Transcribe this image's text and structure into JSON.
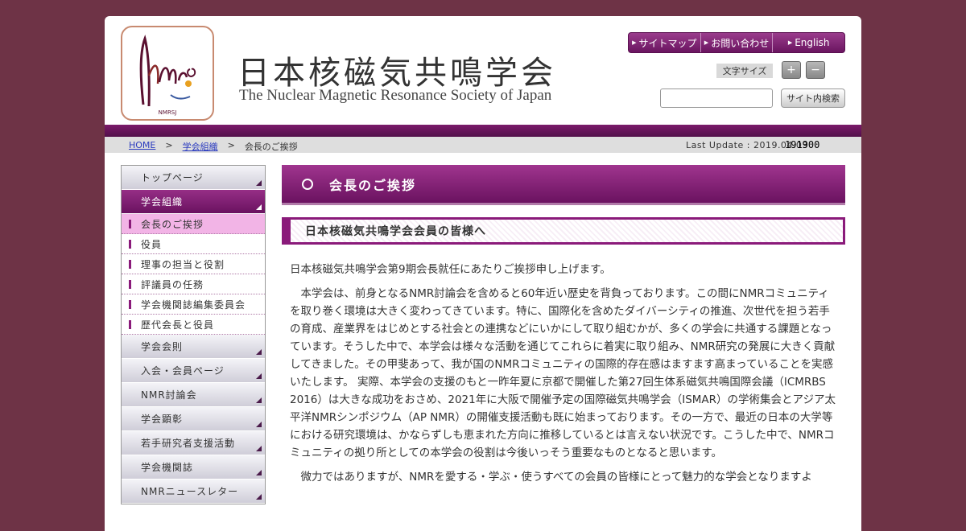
{
  "header": {
    "logo_text": "NMRSJ",
    "title_jp": "日本核磁気共鳴学会",
    "title_en": "The Nuclear Magnetic Resonance Society of Japan"
  },
  "topnav": [
    {
      "label": "サイトマップ"
    },
    {
      "label": "お問い合わせ"
    },
    {
      "label": "English"
    }
  ],
  "font_size": {
    "label": "文字サイズ",
    "plus": "+",
    "minus": "−"
  },
  "search": {
    "button": "サイト内検索",
    "value": ""
  },
  "breadcrumb": {
    "home": "HOME",
    "sep1": ">",
    "org": "学会組織",
    "sep2": ">",
    "current": "会長のご挨拶"
  },
  "last_update": "Last Update : 2019.04.03",
  "counter": "191900",
  "sidebar": {
    "top": "トップページ",
    "org": "学会組織",
    "sub": [
      "会長のご挨拶",
      "役員",
      "理事の担当と役割",
      "評議員の任務",
      "学会機関誌編集委員会",
      "歴代会長と役員"
    ],
    "rest": [
      "学会会則",
      "入会・会員ページ",
      "NMR討論会",
      "学会顕彰",
      "若手研究者支援活動",
      "学会機関誌",
      "NMRニュースレター"
    ]
  },
  "main": {
    "heading": "会長のご挨拶",
    "subheading": "日本核磁気共鳴学会会員の皆様へ",
    "p1": "日本核磁気共鳴学会第9期会長就任にあたりご挨拶申し上げます。",
    "p2": "　本学会は、前身となるNMR討論会を含めると60年近い歴史を背負っております。この間にNMRコミュニティを取り巻く環境は大きく変わってきています。特に、国際化を含めたダイバーシティの推進、次世代を担う若手の育成、産業界をはじめとする社会との連携などにいかにして取り組むかが、多くの学会に共通する課題となっています。そうした中で、本学会は様々な活動を通じてこれらに着実に取り組み、NMR研究の発展に大きく貢献してきました。その甲斐あって、我が国のNMRコミュニティの国際的存在感はますます高まっていることを実感いたします。 実際、本学会の支援のもと一昨年夏に京都で開催した第27回生体系磁気共鳴国際会議（ICMRBS 2016）は大きな成功をおさめ、2021年に大阪で開催予定の国際磁気共鳴学会（ISMAR）の学術集会とアジア太平洋NMRシンポジウム（AP NMR）の開催支援活動も既に始まっております。その一方で、最近の日本の大学等における研究環境は、かならずしも恵まれた方向に推移しているとは言えない状況です。こうした中で、NMRコミュニティの拠り所としての本学会の役割は今後いっそう重要なものとなると思います。",
    "p3": "　微力ではありますが、NMRを愛する・学ぶ・使うすべての会員の皆様にとって魅力的な学会となりますよ"
  },
  "colors": {
    "background": "#6e3346",
    "accent": "#7a1a6a",
    "current_menu": "#f2b4e6",
    "link": "#2b3bbf"
  }
}
